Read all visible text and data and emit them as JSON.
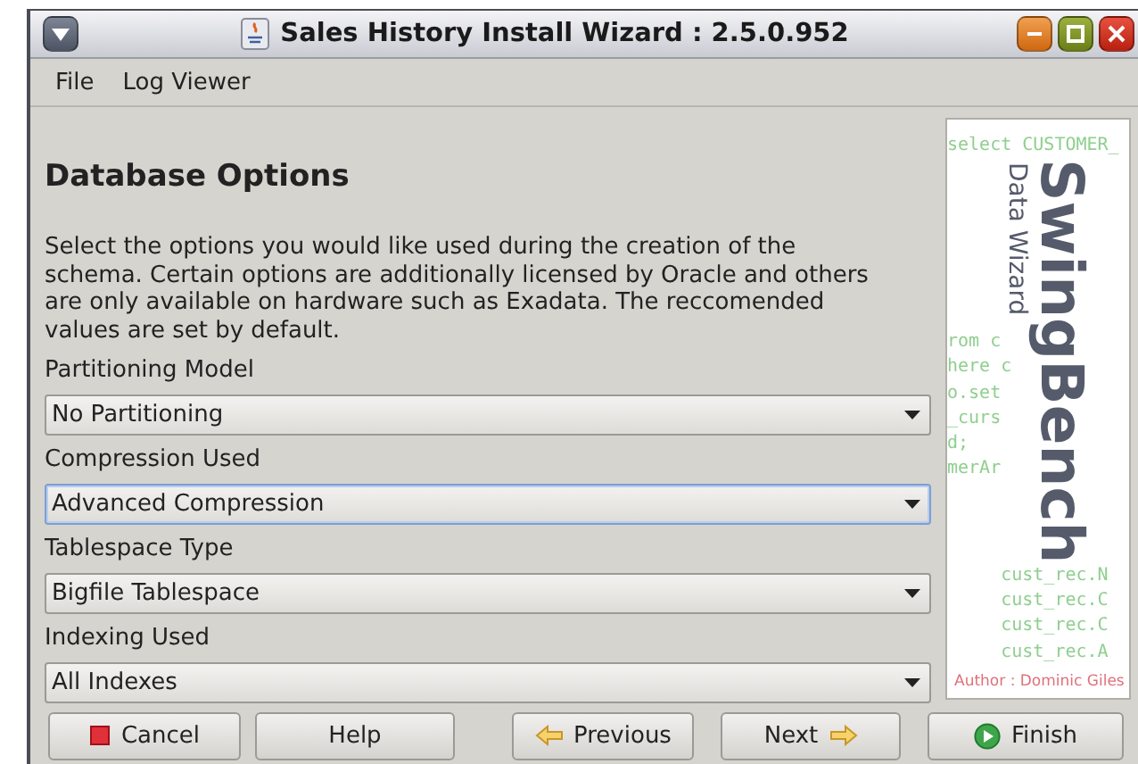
{
  "window": {
    "title": "Sales History Install Wizard : 2.5.0.952"
  },
  "menu": [
    {
      "label": "File"
    },
    {
      "label": "Log Viewer"
    }
  ],
  "page": {
    "heading": "Database Options",
    "description": "Select the options you would like used during the creation of the schema. Certain options are additionally licensed by Oracle and others are only available on hardware such as Exadata. The reccomended values are set by default."
  },
  "fields": [
    {
      "label": "Partitioning Model",
      "value": "No Partitioning",
      "focused": false
    },
    {
      "label": "Compression Used",
      "value": "Advanced Compression",
      "focused": true
    },
    {
      "label": "Tablespace Type",
      "value": "Bigfile Tablespace",
      "focused": false
    },
    {
      "label": "Indexing Used",
      "value": "All Indexes",
      "focused": false
    }
  ],
  "banner": {
    "logo": "SwingBench",
    "subtitle": "Data Wizard",
    "author": "Author : Dominic Giles",
    "code_top": [
      "select CUSTOMER_"
    ],
    "code_left": [
      "rom c",
      "here c",
      "o.set",
      "_curs",
      "d;",
      "merAr"
    ],
    "code_bottom": [
      "     cust_rec.N",
      "     cust_rec.C",
      "     cust_rec.C",
      "     cust_rec.A"
    ]
  },
  "buttons_left": [
    {
      "label": "Cancel",
      "kind": "stop"
    },
    {
      "label": "Help",
      "kind": "plain"
    }
  ],
  "buttons_right": [
    {
      "label": "Previous",
      "kind": "back"
    },
    {
      "label": "Next",
      "kind": "forward"
    },
    {
      "label": "Finish",
      "kind": "play"
    }
  ]
}
